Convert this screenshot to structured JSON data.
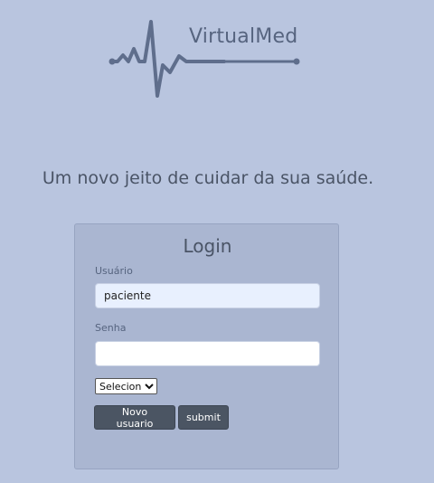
{
  "brand": {
    "name": "VirtualMed",
    "logo_icon": "heartbeat-line-icon",
    "logo_color": "#5f6e8c"
  },
  "tagline": "Um novo jeito de cuidar da sua saúde.",
  "login": {
    "title": "Login",
    "username_label": "Usuário",
    "username_value": "paciente",
    "password_label": "Senha",
    "password_value": "",
    "role_select": {
      "selected": "Selecione",
      "options": [
        "Selecione"
      ]
    },
    "new_user_button": "Novo usuario",
    "submit_button": "submit"
  },
  "colors": {
    "background": "#b9c5df",
    "card": "#aab6d1",
    "button": "#4b5563",
    "autofill": "#e8f0fe"
  }
}
